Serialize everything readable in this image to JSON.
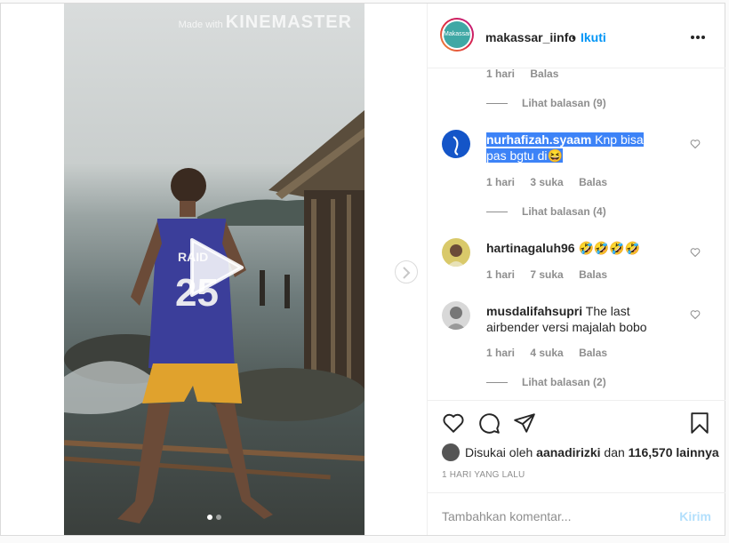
{
  "video": {
    "watermark_prefix": "Made with",
    "watermark_brand": "KINEMASTER",
    "jersey_text": "RAID",
    "jersey_number": "25"
  },
  "header": {
    "username": "makassar_iinfo",
    "separator": "•",
    "follow_label": "Ikuti",
    "avatar_text": "Makassar Info"
  },
  "comments": [
    {
      "time": "1 hari",
      "reply_label": "Balas",
      "view_replies": "Lihat balasan (9)"
    },
    {
      "username": "nurhafizah.syaam",
      "text": "Knp bisa pas bgtu di😆",
      "time": "1 hari",
      "likes": "3 suka",
      "reply_label": "Balas",
      "view_replies": "Lihat balasan (4)"
    },
    {
      "username": "hartinagaluh96",
      "text": "🤣🤣🤣🤣",
      "time": "1 hari",
      "likes": "7 suka",
      "reply_label": "Balas"
    },
    {
      "username": "musdalifahsupri",
      "text": "The last airbender versi majalah bobo",
      "time": "1 hari",
      "likes": "4 suka",
      "reply_label": "Balas",
      "view_replies": "Lihat balasan (2)"
    }
  ],
  "likes": {
    "prefix": "Disukai oleh",
    "user": "aanadirizki",
    "middle": "dan",
    "count": "116,570 lainnya"
  },
  "post_time": "1 HARI YANG LALU",
  "composer": {
    "placeholder": "Tambahkan komentar...",
    "send_label": "Kirim"
  },
  "colors": {
    "accent": "#0095f6",
    "highlight": "#3d83f7",
    "send_disabled": "#b2dffc"
  },
  "icons": [
    "heart-icon",
    "comment-icon",
    "share-icon",
    "bookmark-icon",
    "more-icon",
    "play-icon",
    "chevron-right-icon"
  ]
}
